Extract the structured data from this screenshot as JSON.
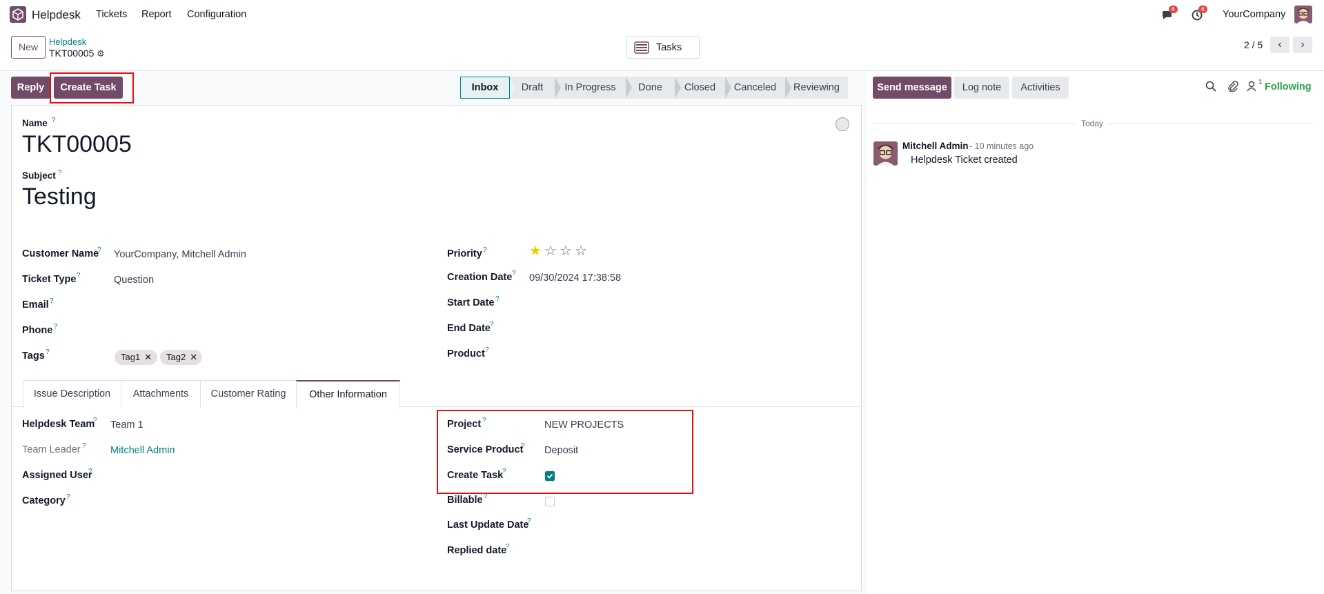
{
  "navbar": {
    "app_name": "Helpdesk",
    "menu": [
      "Tickets",
      "Report",
      "Configuration"
    ],
    "messages_badge": "6",
    "activities_badge": "6",
    "company": "YourCompany"
  },
  "control_panel": {
    "new_label": "New",
    "breadcrumb_parent": "Helpdesk",
    "breadcrumb_current": "TKT00005",
    "smart_button": "Tasks",
    "pager": "2 / 5"
  },
  "statusbar": {
    "reply_label": "Reply",
    "create_task_label": "Create Task",
    "stages": [
      "Inbox",
      "Draft",
      "In Progress",
      "Done",
      "Closed",
      "Canceled",
      "Reviewing"
    ],
    "active_stage": "Inbox"
  },
  "form": {
    "name_label": "Name",
    "name_value": "TKT00005",
    "subject_label": "Subject",
    "subject_value": "Testing",
    "left_fields": {
      "customer_name": {
        "label": "Customer Name",
        "value": "YourCompany, Mitchell Admin"
      },
      "ticket_type": {
        "label": "Ticket Type",
        "value": "Question"
      },
      "email": {
        "label": "Email",
        "value": ""
      },
      "phone": {
        "label": "Phone",
        "value": ""
      },
      "tags": {
        "label": "Tags",
        "values": [
          "Tag1",
          "Tag2"
        ]
      }
    },
    "right_fields": {
      "priority": {
        "label": "Priority",
        "stars": 1,
        "max_stars": 4
      },
      "creation_date": {
        "label": "Creation Date",
        "value": "09/30/2024 17:38:58"
      },
      "start_date": {
        "label": "Start Date",
        "value": ""
      },
      "end_date": {
        "label": "End Date",
        "value": ""
      },
      "product": {
        "label": "Product",
        "value": ""
      }
    },
    "tabs": [
      "Issue Description",
      "Attachments",
      "Customer Rating",
      "Other Information"
    ],
    "active_tab": "Other Information",
    "other_info": {
      "helpdesk_team": {
        "label": "Helpdesk Team",
        "value": "Team 1"
      },
      "team_leader": {
        "label": "Team Leader",
        "value": "Mitchell Admin"
      },
      "assigned_user": {
        "label": "Assigned User",
        "value": ""
      },
      "category": {
        "label": "Category",
        "value": ""
      },
      "project": {
        "label": "Project",
        "value": "NEW PROJECTS"
      },
      "service_product": {
        "label": "Service Product",
        "value": "Deposit"
      },
      "create_task": {
        "label": "Create Task",
        "checked": true
      },
      "billable": {
        "label": "Billable",
        "checked": false
      },
      "last_update_date": {
        "label": "Last Update Date",
        "value": ""
      },
      "replied_date": {
        "label": "Replied date",
        "value": ""
      }
    }
  },
  "chatter": {
    "send_message": "Send message",
    "log_note": "Log note",
    "activities": "Activities",
    "followers_count": "1",
    "following": "Following",
    "date_separator": "Today",
    "messages": [
      {
        "author": "Mitchell Admin",
        "time": "- 10 minutes ago",
        "body": "Helpdesk Ticket created"
      }
    ]
  },
  "colors": {
    "brand": "#714B67",
    "link": "#017e84",
    "highlight": "#e01010",
    "following": "#28a745"
  }
}
